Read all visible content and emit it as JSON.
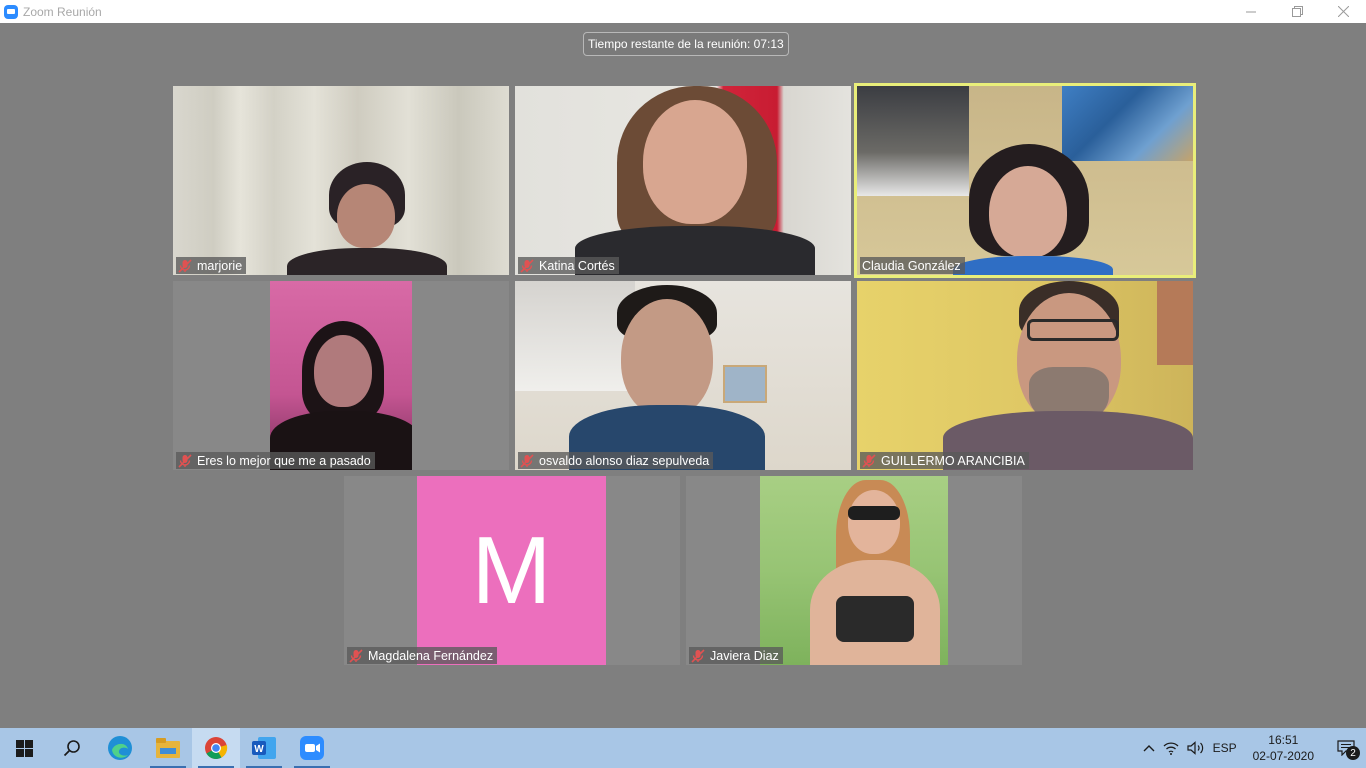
{
  "window": {
    "title": "Zoom Reunión",
    "icon": "zoom-camera-icon"
  },
  "meeting": {
    "timer_text": "Tiempo restante de la reunión: 07:13",
    "participants": [
      {
        "name": "marjorie",
        "muted": true,
        "active_speaker": false,
        "video": "camera"
      },
      {
        "name": "Katina Cortés",
        "muted": true,
        "active_speaker": false,
        "video": "camera"
      },
      {
        "name": "Claudia González",
        "muted": false,
        "active_speaker": true,
        "video": "camera"
      },
      {
        "name": "Eres lo mejor que me a pasado",
        "muted": true,
        "active_speaker": false,
        "video": "camera"
      },
      {
        "name": "osvaldo alonso diaz sepulveda",
        "muted": true,
        "active_speaker": false,
        "video": "camera"
      },
      {
        "name": "GUILLERMO ARANCIBIA",
        "muted": true,
        "active_speaker": false,
        "video": "camera"
      },
      {
        "name": "Magdalena Fernández",
        "muted": true,
        "active_speaker": false,
        "video": "avatar",
        "avatar_letter": "M",
        "avatar_color": "#ec6fbd"
      },
      {
        "name": "Javiera Diaz",
        "muted": true,
        "active_speaker": false,
        "video": "camera"
      }
    ],
    "colors": {
      "active_speaker_border": "#e9ee7a",
      "muted_icon": "#e05252"
    }
  },
  "taskbar": {
    "apps": [
      {
        "icon": "windows-start-icon"
      },
      {
        "icon": "search-icon"
      },
      {
        "icon": "edge-browser-icon"
      },
      {
        "icon": "file-explorer-icon"
      },
      {
        "icon": "chrome-browser-icon"
      },
      {
        "icon": "word-icon"
      },
      {
        "icon": "zoom-app-icon"
      }
    ],
    "tray": {
      "language": "ESP",
      "time": "16:51",
      "date": "02-07-2020",
      "notification_count": "2"
    }
  }
}
